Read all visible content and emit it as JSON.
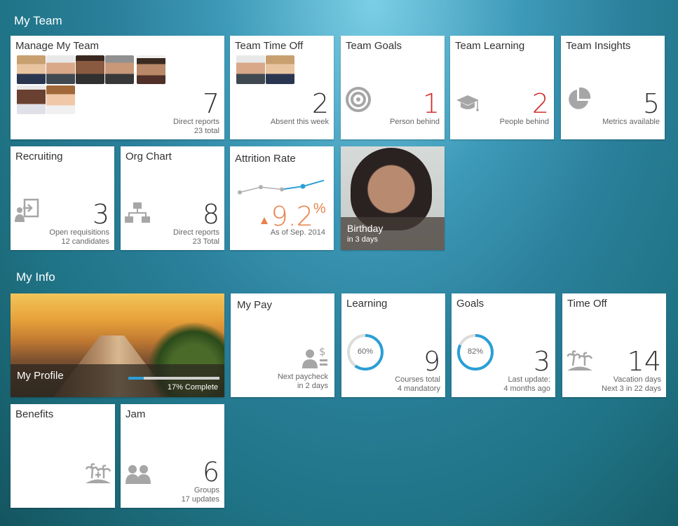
{
  "sections": {
    "team": "My Team",
    "info": "My Info"
  },
  "tiles": {
    "manage_team": {
      "title": "Manage My Team",
      "number": "7",
      "line1": "Direct reports",
      "line2": "23 total"
    },
    "team_time_off": {
      "title": "Team Time Off",
      "number": "2",
      "line1": "Absent this week"
    },
    "team_goals": {
      "title": "Team Goals",
      "number": "1",
      "line1": "Person behind"
    },
    "team_learning": {
      "title": "Team Learning",
      "number": "2",
      "line1": "People behind"
    },
    "team_insights": {
      "title": "Team Insights",
      "number": "5",
      "line1": "Metrics available"
    },
    "recruiting": {
      "title": "Recruiting",
      "number": "3",
      "line1": "Open requisitions",
      "line2": "12 candidates"
    },
    "org_chart": {
      "title": "Org Chart",
      "number": "8",
      "line1": "Direct reports",
      "line2": "23 Total"
    },
    "attrition": {
      "title": "Attrition Rate",
      "value": "9.2",
      "unit": "%",
      "line1": "As of Sep. 2014"
    },
    "birthday": {
      "title": "Birthday",
      "line1": "in 3 days"
    },
    "my_profile": {
      "title": "My Profile",
      "progress_label": "17% Complete",
      "progress": 0.17
    },
    "my_pay": {
      "title": "My Pay",
      "line1": "Next paycheck",
      "line2": "in 2 days"
    },
    "learning": {
      "title": "Learning",
      "ring_label": "60%",
      "ring_value": 0.6,
      "number": "9",
      "line1": "Courses total",
      "line2": "4 mandatory"
    },
    "goals": {
      "title": "Goals",
      "ring_label": "82%",
      "ring_value": 0.82,
      "number": "3",
      "line1": "Last update:",
      "line2": "4 months ago"
    },
    "time_off": {
      "title": "Time Off",
      "number": "14",
      "line1": "Vacation days",
      "line2": "Next 3 in 22 days"
    },
    "benefits": {
      "title": "Benefits"
    },
    "jam": {
      "title": "Jam",
      "number": "6",
      "line1": "Groups",
      "line2": "17 updates"
    }
  },
  "colors": {
    "accent": "#2a9fd6",
    "alert": "#d0302e",
    "attrition": "#e8824a",
    "icon_gray": "#a6a6a6"
  },
  "chart_data": {
    "type": "line",
    "x": [
      1,
      2,
      3,
      4,
      5
    ],
    "values": [
      7.6,
      8.3,
      8.0,
      8.4,
      9.2
    ],
    "ylim": [
      7,
      10
    ]
  }
}
